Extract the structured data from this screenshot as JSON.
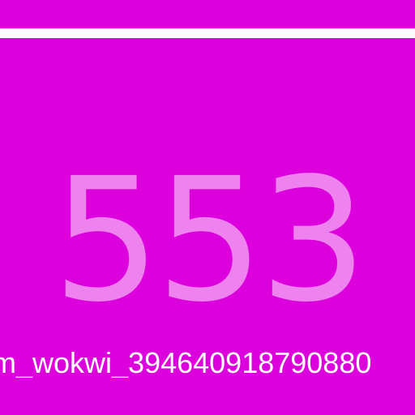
{
  "display": {
    "background_color": "#dc00dc",
    "top_rule_color": "#ffffff",
    "value": "553",
    "value_color": "#ee82ee",
    "device_id": "m_wokwi_394640918790880",
    "device_id_color": "#ffffff"
  }
}
